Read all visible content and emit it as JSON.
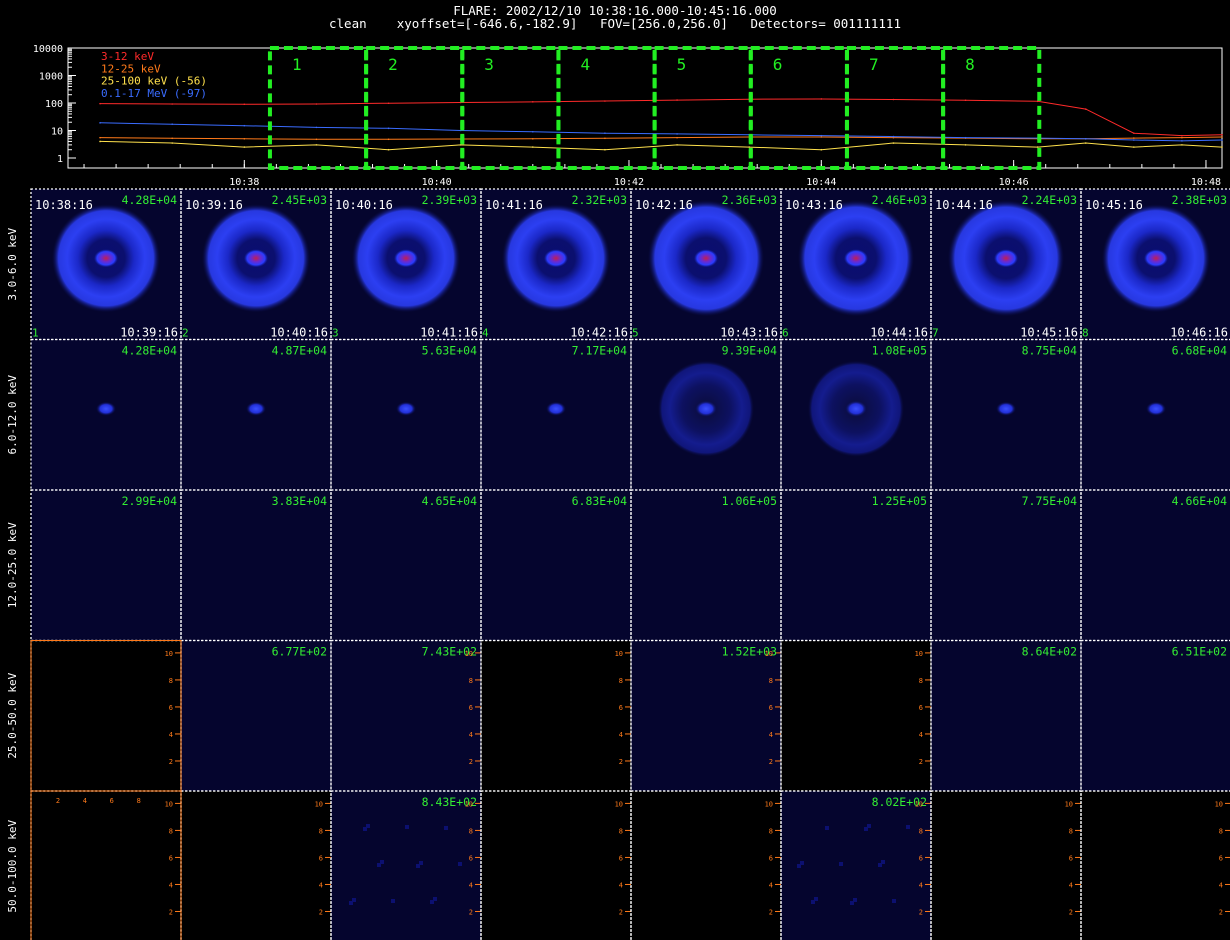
{
  "header": {
    "line1": "FLARE: 2002/12/10 10:38:16.000-10:45:16.000",
    "method": "clean",
    "xyoffset": "xyoffset=[-646.6,-182.9]",
    "fov": "FOV=[256.0,256.0]",
    "detectors": "Detectors= 001111111"
  },
  "lightcurve": {
    "y_ticks": [
      "10000",
      "1000",
      "100",
      "10",
      "1"
    ],
    "x_ticks": [
      "10:38",
      "10:40",
      "10:42",
      "10:44",
      "10:46",
      "10:48"
    ],
    "intervals": [
      "1",
      "2",
      "3",
      "4",
      "5",
      "6",
      "7",
      "8"
    ],
    "legend": [
      {
        "label": "3-12 keV",
        "color": "#ff2a2a"
      },
      {
        "label": "12-25 keV",
        "color": "#ff7a1a"
      },
      {
        "label": "25-100 keV (-56)",
        "color": "#ffe14d"
      },
      {
        "label": "0.1-17 MeV (-97)",
        "color": "#3a6cff"
      }
    ],
    "interval_color": "#22ee22"
  },
  "chart_data": {
    "type": "line",
    "title": "FLARE: 2002/12/10 10:38:16.000-10:45:16.000",
    "ylabel": "",
    "xlabel": "",
    "yscale": "log",
    "ylim": [
      1,
      10000
    ],
    "xlim": [
      "10:36:10",
      "10:48:10"
    ],
    "x": [
      "10:36:30",
      "10:37:15",
      "10:38:00",
      "10:38:45",
      "10:39:30",
      "10:40:15",
      "10:41:00",
      "10:41:45",
      "10:42:30",
      "10:43:15",
      "10:44:00",
      "10:44:45",
      "10:45:30",
      "10:46:15",
      "10:46:45",
      "10:47:15",
      "10:47:45",
      "10:48:10"
    ],
    "series": [
      {
        "name": "3-12 keV",
        "values": [
          95,
          92,
          90,
          92,
          98,
          104,
          110,
          118,
          128,
          137,
          140,
          134,
          126,
          115,
          60,
          8,
          6.5,
          7
        ]
      },
      {
        "name": "12-25 keV",
        "values": [
          5.5,
          5.2,
          5.0,
          4.8,
          4.8,
          4.9,
          5.0,
          5.2,
          5.5,
          5.8,
          5.8,
          5.5,
          5.3,
          5.0,
          5.0,
          5.3,
          5.5,
          5.8
        ]
      },
      {
        "name": "25-100 keV (-56)",
        "values": [
          4.0,
          3.5,
          2.5,
          3.0,
          2.0,
          3.0,
          2.5,
          2.0,
          3.0,
          2.5,
          2.0,
          3.5,
          3.0,
          2.5,
          3.5,
          2.5,
          3.0,
          2.5
        ]
      },
      {
        "name": "0.1-17 MeV (-97)",
        "values": [
          19,
          17,
          15,
          13,
          12,
          10,
          9,
          8,
          7.5,
          7,
          6.5,
          6,
          5.5,
          5.3,
          5,
          4.5,
          4.2,
          4.5
        ]
      }
    ],
    "intervals": [
      "1",
      "2",
      "3",
      "4",
      "5",
      "6",
      "7",
      "8"
    ],
    "image_grid": {
      "energy_bands": [
        "3.0-6.0 keV",
        "6.0-12.0 keV",
        "12.0-25.0 keV",
        "25.0-50.0 keV",
        "50.0-100.0 keV"
      ],
      "start_times": [
        "10:38:16",
        "10:39:16",
        "10:40:16",
        "10:41:16",
        "10:42:16",
        "10:43:16",
        "10:44:16",
        "10:45:16"
      ],
      "end_times": [
        "10:39:16",
        "10:40:16",
        "10:41:16",
        "10:42:16",
        "10:43:16",
        "10:44:16",
        "10:45:16",
        "10:46:16"
      ],
      "interval_numbers": [
        "1",
        "2",
        "3",
        "4",
        "5",
        "6",
        "7",
        "8"
      ],
      "max_values": [
        [
          "4.28E+04",
          "2.45E+03",
          "2.39E+03",
          "2.32E+03",
          "2.36E+03",
          "2.46E+03",
          "2.24E+03",
          "2.38E+03"
        ],
        [
          "4.28E+04",
          "4.87E+04",
          "5.63E+04",
          "7.17E+04",
          "9.39E+04",
          "1.08E+05",
          "8.75E+04",
          "6.68E+04"
        ],
        [
          "2.99E+04",
          "3.83E+04",
          "4.65E+04",
          "6.83E+04",
          "1.06E+05",
          "1.25E+05",
          "7.75E+04",
          "4.66E+04"
        ],
        [
          "",
          "6.77E+02",
          "7.43E+02",
          "",
          "1.52E+03",
          "",
          "8.64E+02",
          "6.51E+02"
        ],
        [
          "",
          "",
          "8.43E+02",
          "",
          "",
          "8.02E+02",
          "",
          ""
        ]
      ],
      "panel_kind": [
        [
          "ring",
          "ring",
          "ring",
          "ring",
          "ring",
          "ring",
          "ring",
          "ring"
        ],
        [
          "blob",
          "blob",
          "blob",
          "blob",
          "ring",
          "ring",
          "blob",
          "blob"
        ],
        [
          "empty",
          "empty",
          "empty",
          "empty",
          "empty",
          "empty",
          "empty",
          "empty"
        ],
        [
          "black",
          "empty",
          "empty",
          "black",
          "empty",
          "black",
          "empty",
          "empty"
        ],
        [
          "black",
          "black",
          "noise",
          "black",
          "black",
          "noise",
          "black",
          "black"
        ]
      ],
      "axis_tick_labels": [
        "2",
        "4",
        "6",
        "8",
        "10"
      ]
    }
  }
}
